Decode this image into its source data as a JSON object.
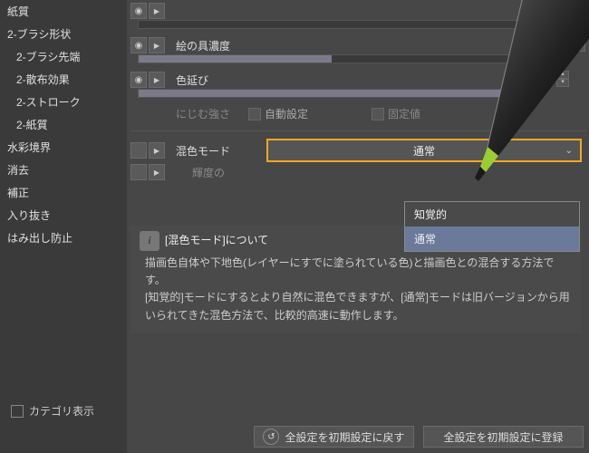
{
  "sidebar": {
    "items": [
      {
        "label": "紙質"
      },
      {
        "label": "2-ブラシ形状"
      },
      {
        "label": "2-ブラシ先端",
        "sub": true
      },
      {
        "label": "2-散布効果",
        "sub": true
      },
      {
        "label": "2-ストローク",
        "sub": true
      },
      {
        "label": "2-紙質",
        "sub": true
      },
      {
        "label": "水彩境界"
      },
      {
        "label": "消去"
      },
      {
        "label": "補正"
      },
      {
        "label": "入り抜き"
      },
      {
        "label": "はみ出し防止"
      }
    ]
  },
  "params": {
    "paint_density": {
      "label": "絵の具濃度",
      "value": "50"
    },
    "color_stretch": {
      "label": "色延び",
      "value": "100"
    },
    "bleed_strength": "にじむ強さ",
    "auto_set": "自動設定",
    "fixed": "固定値",
    "blend_mode_label": "混色モード",
    "blend_mode_value": "通常",
    "luminance": "輝度の",
    "menu": {
      "opt1": "知覚的",
      "opt2": "通常"
    }
  },
  "info": {
    "title": "[混色モード]について",
    "body1": "描画色自体や下地色(レイヤーにすでに塗られている色)と描画色との混合する方法です。",
    "body2": "[知覚的]モードにするとより自然に混色できますが、[通常]モードは旧バージョンから用いられてきた混色方法で、比較的高速に動作します。"
  },
  "footer": {
    "category": "カテゴリ表示",
    "reset": "全設定を初期設定に戻す",
    "register": "全設定を初期設定に登録"
  }
}
